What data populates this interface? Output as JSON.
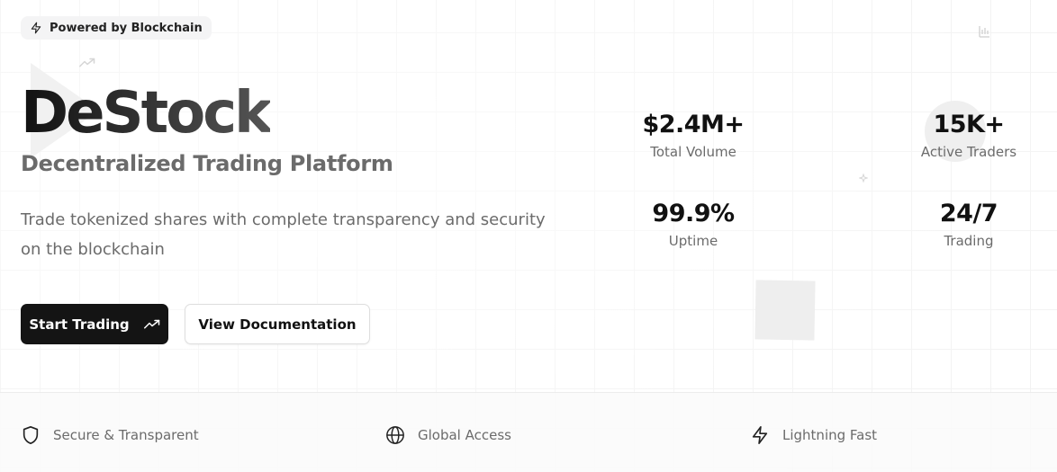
{
  "badge": {
    "icon": "lightning-icon",
    "label": "Powered by Blockchain"
  },
  "hero": {
    "brand": "DeStock",
    "subtitle": "Decentralized Trading Platform",
    "description": "Trade tokenized shares with complete transparency and security on the blockchain"
  },
  "actions": {
    "primary": {
      "label": "Start Trading",
      "icon": "trending-up-icon"
    },
    "secondary": {
      "label": "View Documentation"
    }
  },
  "stats": [
    {
      "value": "$2.4M+",
      "label": "Total Volume"
    },
    {
      "value": "15K+",
      "label": "Active Traders"
    },
    {
      "value": "99.9%",
      "label": "Uptime"
    },
    {
      "value": "24/7",
      "label": "Trading"
    }
  ],
  "features": [
    {
      "icon": "shield-icon",
      "label": "Secure & Transparent"
    },
    {
      "icon": "globe-icon",
      "label": "Global Access"
    },
    {
      "icon": "lightning-icon",
      "label": "Lightning Fast"
    }
  ],
  "colors": {
    "primary_button_bg": "#141414",
    "text_muted": "#6b6b6b",
    "badge_bg": "#f4f4f5"
  }
}
